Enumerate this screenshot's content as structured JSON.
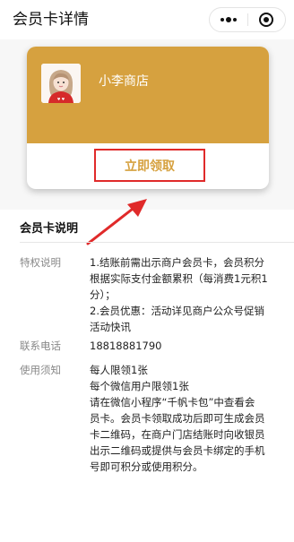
{
  "nav": {
    "title": "会员卡详情",
    "more_icon": "more-dots-icon",
    "close_icon": "target-circle-icon"
  },
  "card": {
    "shop_name": "小李商店",
    "claim_label": "立即领取",
    "accent_color": "#d6a13f",
    "claim_border_color": "#e02a2a",
    "logo_icon": "shop-avatar-icon"
  },
  "section": {
    "title": "会员卡说明"
  },
  "details": [
    {
      "label": "特权说明",
      "lines": [
        "1.结账前需出示商户会员卡，会员积分",
        "根据实际支付金额累积（每消费1元积1",
        "分）；",
        "2.会员优惠：活动详见商户公众号促销",
        "活动快讯"
      ]
    },
    {
      "label": "联系电话",
      "lines": [
        "18818881790"
      ]
    },
    {
      "label": "使用须知",
      "lines": [
        "每人限领1张",
        "每个微信用户限领1张",
        "请在微信小程序“千帆卡包”中查看会",
        "员卡。会员卡领取成功后即可生成会员",
        "卡二维码，在商户门店结账时向收银员",
        "出示二维码或提供与会员卡绑定的手机",
        "号即可积分或使用积分。"
      ]
    }
  ]
}
